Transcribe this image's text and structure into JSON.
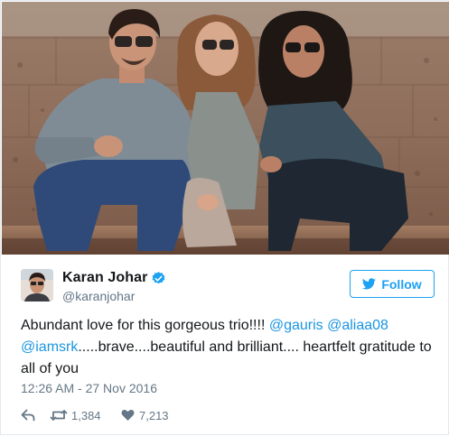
{
  "tweet": {
    "author": {
      "display_name": "Karan Johar",
      "handle": "@karanjohar",
      "verified": true,
      "avatar_icon": "profile-photo"
    },
    "follow_label": "Follow",
    "follow_icon": "twitter-bird-icon",
    "text": {
      "part1": "Abundant love for this gorgeous trio!!!! ",
      "mention1": "@gauris",
      "space1": " ",
      "mention2": "@aliaa08",
      "space2": " ",
      "mention3": "@iamsrk",
      "part2": ".....brave....beautiful and brilliant.... heartfelt gratitude to all of you"
    },
    "timestamp": "12:26 AM - 27 Nov 2016",
    "actions": {
      "reply_icon": "reply-icon",
      "retweet_icon": "retweet-icon",
      "retweet_count": "1,384",
      "like_icon": "heart-icon",
      "like_count": "7,213"
    }
  },
  "colors": {
    "accent": "#1da1f2",
    "mention": "#1b95e0",
    "secondary_text": "#657786",
    "primary_text": "#14171a",
    "border": "#e1e8ed"
  }
}
